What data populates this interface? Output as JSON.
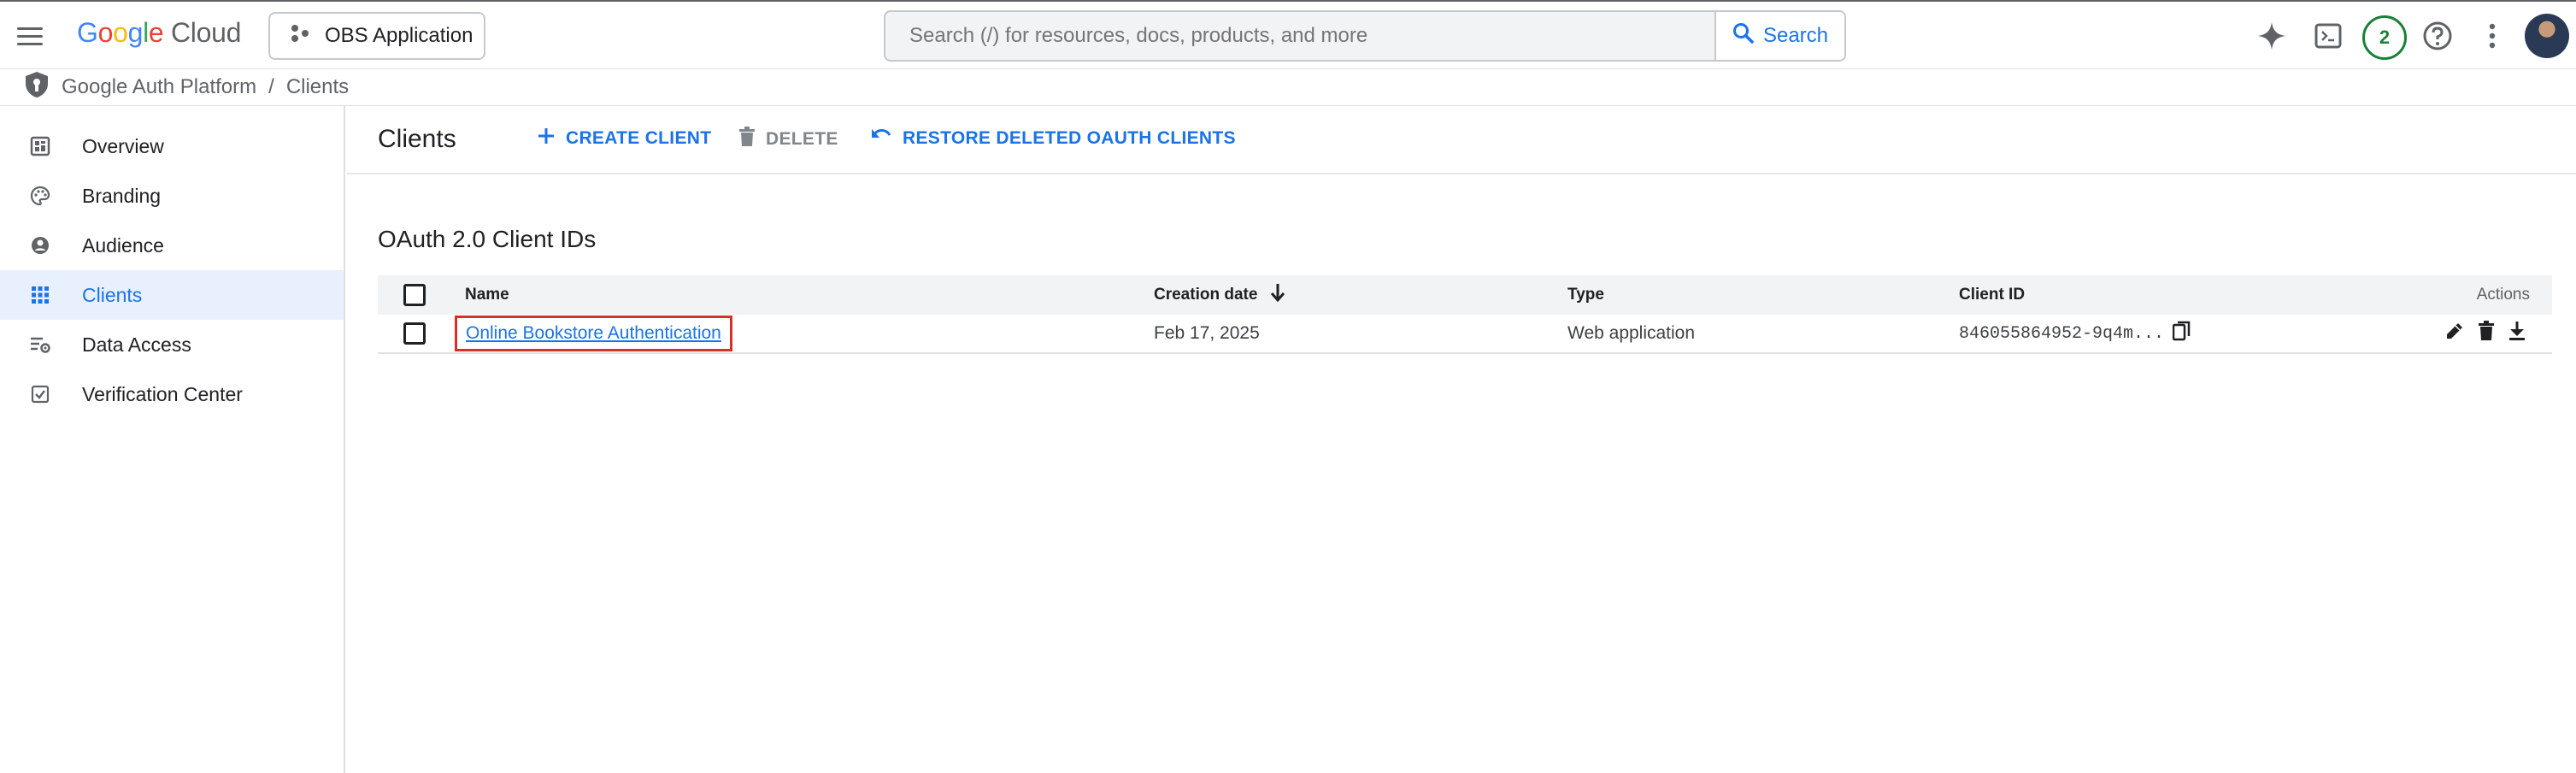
{
  "header": {
    "logo_google": "Google",
    "logo_cloud": "Cloud",
    "project_label": "OBS Application",
    "search_placeholder": "Search (/) for resources, docs, products, and more",
    "search_button": "Search",
    "notification_count": "2"
  },
  "breadcrumb": {
    "items": [
      "Google Auth Platform",
      "Clients"
    ],
    "separator": "/"
  },
  "sidebar": {
    "items": [
      {
        "label": "Overview",
        "icon": "dashboard-icon"
      },
      {
        "label": "Branding",
        "icon": "palette-icon"
      },
      {
        "label": "Audience",
        "icon": "account-circle-icon"
      },
      {
        "label": "Clients",
        "icon": "apps-grid-icon",
        "active": true
      },
      {
        "label": "Data Access",
        "icon": "data-settings-icon"
      },
      {
        "label": "Verification Center",
        "icon": "verified-check-icon"
      }
    ]
  },
  "main": {
    "title": "Clients",
    "toolbar": {
      "create": "CREATE CLIENT",
      "delete": "DELETE",
      "restore": "RESTORE DELETED OAUTH CLIENTS"
    },
    "section_title": "OAuth 2.0 Client IDs",
    "table": {
      "columns": {
        "name": "Name",
        "creation_date": "Creation date",
        "type": "Type",
        "client_id": "Client ID",
        "actions": "Actions"
      },
      "rows": [
        {
          "name": "Online Bookstore Authentication",
          "creation_date": "Feb 17, 2025",
          "type": "Web application",
          "client_id": "846055864952-9q4m..."
        }
      ]
    }
  },
  "colors": {
    "accent": "#1a73e8",
    "active_bg": "#e8f0fe",
    "highlight_border": "#d93025",
    "badge": "#188038"
  }
}
